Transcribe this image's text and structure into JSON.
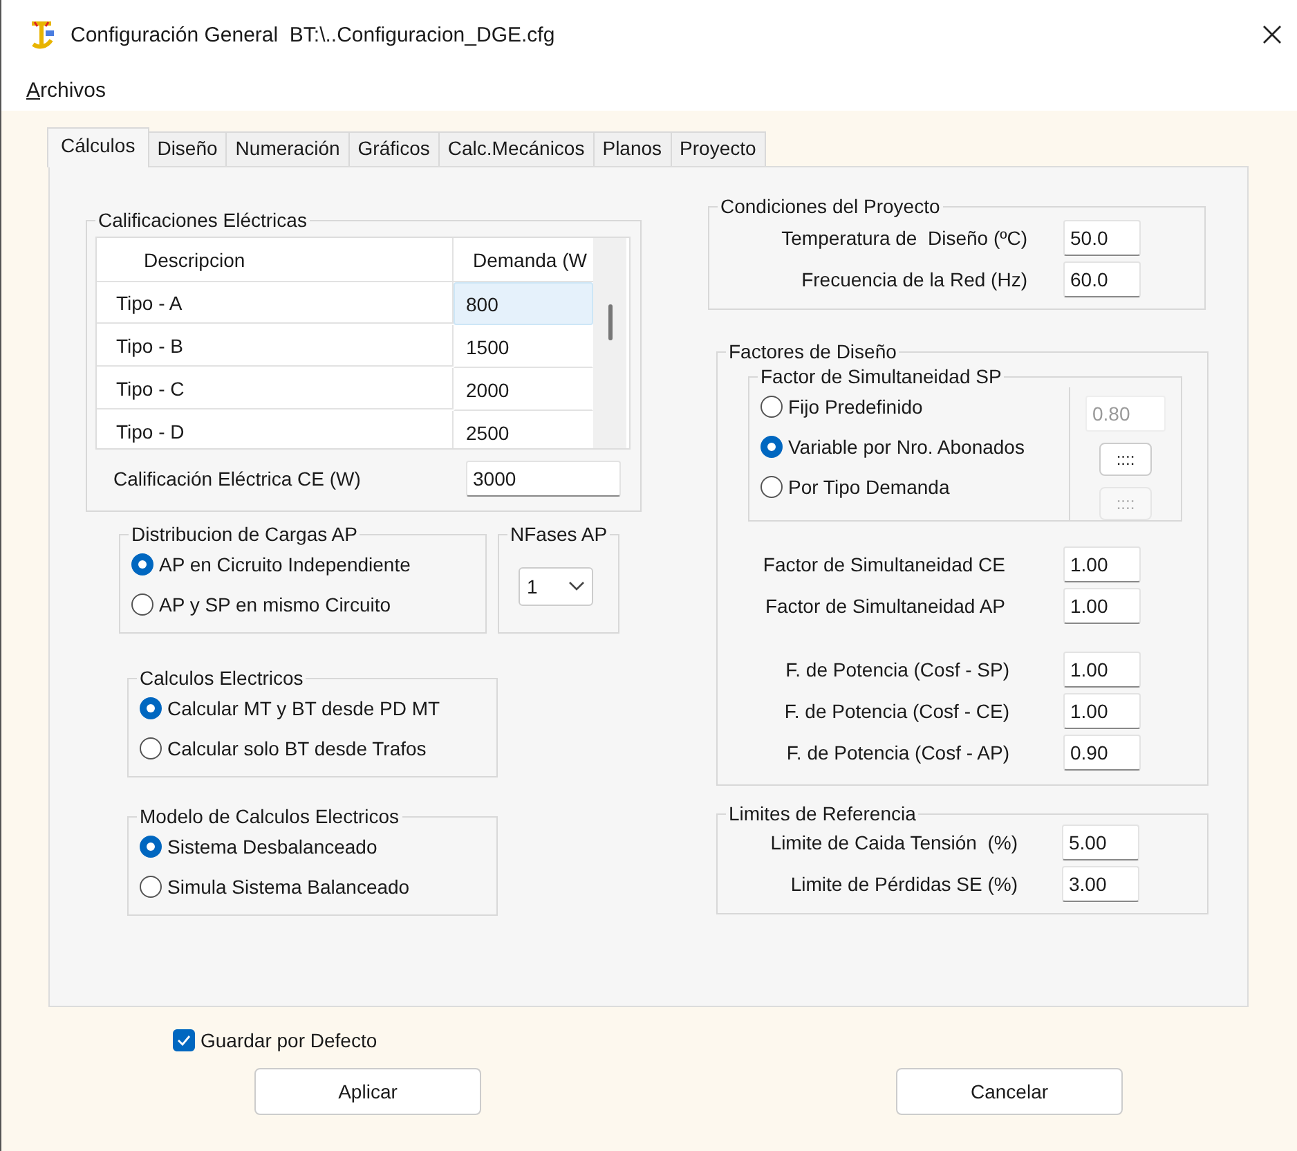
{
  "window": {
    "title": "Configuración General  BT:\\..Configuracion_DGE.cfg"
  },
  "menu": [
    {
      "label": "Archivos"
    }
  ],
  "tabs": [
    {
      "label": "Cálculos",
      "selected": true
    },
    {
      "label": "Diseño",
      "selected": false
    },
    {
      "label": "Numeración",
      "selected": false
    },
    {
      "label": "Gráficos",
      "selected": false
    },
    {
      "label": "Calc.Mecánicos",
      "selected": false
    },
    {
      "label": "Planos",
      "selected": false
    },
    {
      "label": "Proyecto",
      "selected": false
    }
  ],
  "ratings": {
    "title": "Calificaciones Eléctricas",
    "columns": [
      "Descripcion",
      "Demanda (W"
    ],
    "rows": [
      {
        "description": "Tipo - A",
        "demand": "800",
        "selected": true
      },
      {
        "description": "Tipo - B",
        "demand": "1500",
        "selected": false
      },
      {
        "description": "Tipo - C",
        "demand": "2000",
        "selected": false
      },
      {
        "description": "Tipo - D",
        "demand": "2500",
        "selected": false
      }
    ],
    "field": {
      "label": "Calificación Eléctrica CE (W)",
      "value": "3000"
    }
  },
  "distribution": {
    "title": "Distribucion de Cargas AP",
    "options": [
      {
        "label": "AP en Cicruito Independiente",
        "selected": true
      },
      {
        "label": "AP y SP en mismo Circuito",
        "selected": false
      }
    ]
  },
  "phases": {
    "title": "NFases AP",
    "value": "1"
  },
  "calculations": {
    "title": "Calculos Electricos",
    "options": [
      {
        "label": "Calcular MT y BT desde PD MT",
        "selected": true
      },
      {
        "label": "Calcular solo BT desde Trafos",
        "selected": false
      }
    ]
  },
  "model": {
    "title": "Modelo de Calculos Electricos",
    "options": [
      {
        "label": "Sistema Desbalanceado",
        "selected": true
      },
      {
        "label": "Simula Sistema Balanceado",
        "selected": false
      }
    ]
  },
  "conditions": {
    "title": "Condiciones del Proyecto",
    "fields": [
      {
        "label": "Temperatura de  Diseño (ºC)",
        "value": "50.0"
      },
      {
        "label": "Frecuencia de la Red (Hz)",
        "value": "60.0"
      }
    ]
  },
  "factors": {
    "title": "Factores de Diseño",
    "sp": {
      "title": "Factor de Simultaneidad SP",
      "options": [
        {
          "label": "Fijo Predefinido",
          "selected": false
        },
        {
          "label": "Variable por Nro. Abonados",
          "selected": true
        },
        {
          "label": "Por Tipo Demanda",
          "selected": false
        }
      ],
      "side_controls": [
        {
          "kind": "field",
          "value": "0.80",
          "disabled": true
        },
        {
          "kind": "button",
          "label": "::::",
          "disabled": false
        },
        {
          "kind": "button",
          "label": "::::",
          "disabled": true
        }
      ]
    },
    "simultaneity_fields": [
      {
        "label": "Factor de Simultaneidad CE",
        "value": "1.00"
      },
      {
        "label": "Factor de Simultaneidad AP",
        "value": "1.00"
      }
    ],
    "power_factor_fields": [
      {
        "label": "F. de Potencia (Cosf - SP)",
        "value": "1.00"
      },
      {
        "label": "F. de Potencia (Cosf - CE)",
        "value": "1.00"
      },
      {
        "label": "F. de Potencia (Cosf - AP)",
        "value": "0.90"
      }
    ]
  },
  "limits": {
    "title": "Limites de Referencia",
    "fields": [
      {
        "label": "Limite de Caida Tensión  (%)",
        "value": "5.00"
      },
      {
        "label": "Limite de Pérdidas SE (%)",
        "value": "3.00"
      }
    ]
  },
  "save_default": {
    "label": "Guardar por Defecto",
    "checked": true
  },
  "buttons": [
    "Aplicar",
    "Cancelar"
  ]
}
